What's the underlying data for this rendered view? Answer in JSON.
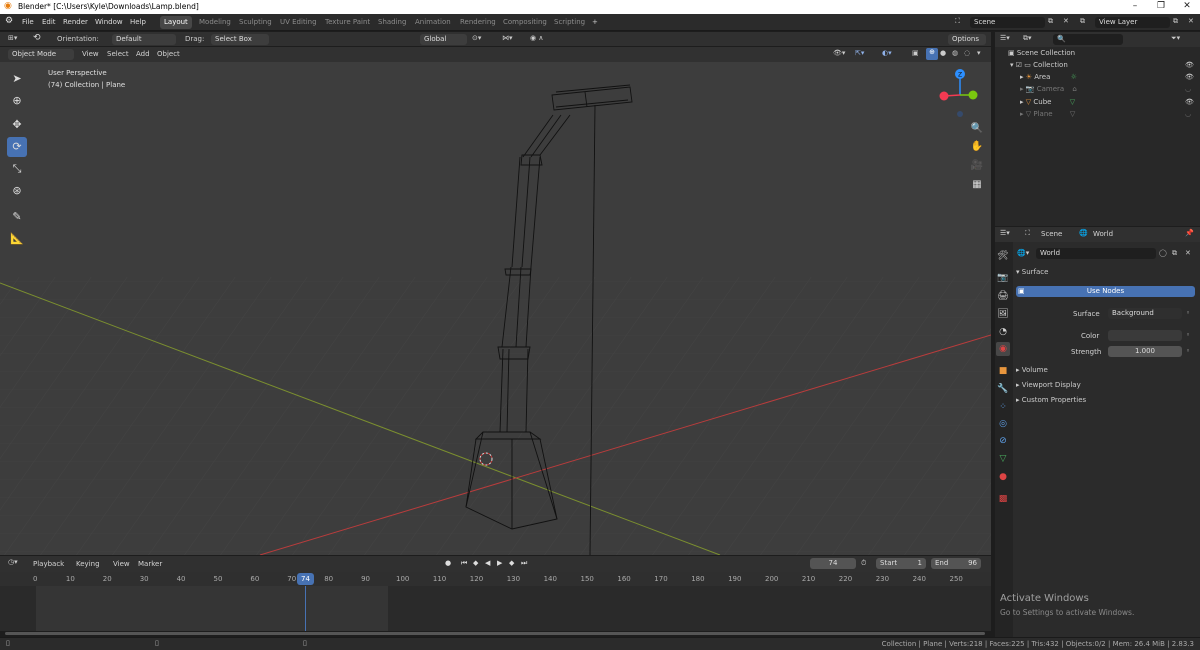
{
  "window": {
    "title": "Blender* [C:\\Users\\Kyle\\Downloads\\Lamp.blend]"
  },
  "menu": [
    "File",
    "Edit",
    "Render",
    "Window",
    "Help"
  ],
  "workspaces": [
    {
      "label": "Layout",
      "active": true
    },
    {
      "label": "Modeling"
    },
    {
      "label": "Sculpting"
    },
    {
      "label": "UV Editing"
    },
    {
      "label": "Texture Paint"
    },
    {
      "label": "Shading"
    },
    {
      "label": "Animation"
    },
    {
      "label": "Rendering"
    },
    {
      "label": "Compositing"
    },
    {
      "label": "Scripting"
    },
    {
      "label": "+"
    }
  ],
  "scene_field": "Scene",
  "view_layer_field": "View Layer",
  "tool_header": {
    "orientation_label": "Orientation:",
    "orientation_value": "Default",
    "drag_label": "Drag:",
    "drag_value": "Select Box",
    "transform_space": "Global",
    "options": "Options"
  },
  "viewport_header": {
    "mode": "Object Mode",
    "menus": [
      "View",
      "Select",
      "Add",
      "Object"
    ]
  },
  "viewport": {
    "perspective": "User Perspective",
    "collection_info": "(74) Collection | Plane"
  },
  "gizmo_axes": {
    "x": "X",
    "y": "Y",
    "z": "Z",
    "colors": {
      "x": "#f53a52",
      "y": "#7ac70f",
      "z": "#2c8fff"
    }
  },
  "outliner": {
    "root": "Scene Collection",
    "items": [
      {
        "label": "Collection",
        "level": 1
      },
      {
        "label": "Area",
        "level": 2
      },
      {
        "label": "Camera",
        "level": 2
      },
      {
        "label": "Cube",
        "level": 2
      },
      {
        "label": "Plane",
        "level": 2
      }
    ]
  },
  "properties": {
    "breadcrumb_scene": "Scene",
    "breadcrumb_world": "World",
    "world_name": "World",
    "surface_section": "Surface",
    "use_nodes": "Use Nodes",
    "surface_label": "Surface",
    "surface_value": "Background",
    "color_label": "Color",
    "strength_label": "Strength",
    "strength_value": "1.000",
    "collapsed_sections": [
      "Volume",
      "Viewport Display",
      "Custom Properties"
    ]
  },
  "timeline": {
    "menus": [
      "Playback",
      "Keying",
      "View",
      "Marker"
    ],
    "current_frame": "74",
    "start_label": "Start",
    "start_value": "1",
    "end_label": "End",
    "end_value": "96",
    "ruler": [
      "0",
      "10",
      "20",
      "30",
      "40",
      "50",
      "60",
      "70",
      "80",
      "90",
      "100",
      "110",
      "120",
      "130",
      "140",
      "150",
      "160",
      "170",
      "180",
      "190",
      "200",
      "210",
      "220",
      "230",
      "240",
      "250"
    ]
  },
  "status_bar": "Collection | Plane | Verts:218 | Faces:225 | Tris:432 | Objects:0/2 | Mem: 26.4 MiB | 2.83.3",
  "watermark": {
    "title": "Activate Windows",
    "subtitle": "Go to Settings to activate Windows."
  },
  "colors": {
    "accent": "#4772b3",
    "viewport_bg": "#3d3d3d",
    "x_axis": "#b83c3c",
    "y_axis": "#7b8f2f"
  }
}
